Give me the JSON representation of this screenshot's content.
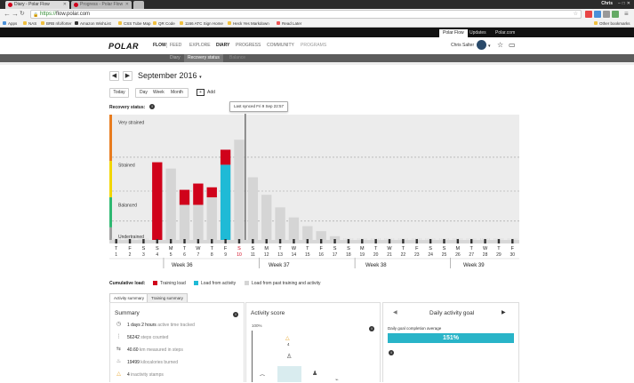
{
  "browser": {
    "tabs": [
      {
        "label": "Diary - Polar Flow",
        "active": true
      },
      {
        "label": "Progress - Polar Flow",
        "active": false
      }
    ],
    "window_user": "Chris",
    "url_scheme": "https://",
    "url_host": "flow.polar.com",
    "bookmarks": [
      "Apps",
      "NAS",
      "BRB nfo/forter",
      "Amazon WishList",
      "CSS Tube Map",
      "QR Code",
      "1166 ATC Sign Home",
      "Heck Yes Markdown",
      "Read Later"
    ],
    "other_bookmarks": "Other bookmarks"
  },
  "polar_top": {
    "tabs": [
      "Polar Flow",
      "Updates",
      "Polar.com"
    ]
  },
  "header": {
    "logo": "POLAR",
    "nav": [
      "FLOW",
      "FEED",
      "EXPLORE",
      "DIARY",
      "PROGRESS",
      "COMMUNITY",
      "PROGRAMS"
    ],
    "active_nav": "DIARY",
    "user_name": "Chris Salter"
  },
  "subnav": {
    "items": [
      "Diary",
      "Recovery status",
      "Balance"
    ],
    "active": "Recovery status"
  },
  "calendar": {
    "month": "September 2016",
    "today": "Today",
    "views": [
      "Day",
      "Week",
      "Month"
    ],
    "add": "Add"
  },
  "recovery": {
    "label": "Recovery status:",
    "tooltip": "Last synced Fri 9 Sep 22:57"
  },
  "chart_data": {
    "type": "bar",
    "levels": [
      "Very strained",
      "Strained",
      "Balanced",
      "Undertrained"
    ],
    "day_letters": [
      "T",
      "F",
      "S",
      "S",
      "M",
      "T",
      "W",
      "T",
      "F",
      "S",
      "S",
      "M",
      "T",
      "W",
      "T",
      "F",
      "S",
      "S",
      "M",
      "T",
      "W",
      "T",
      "F",
      "S",
      "S",
      "M",
      "T",
      "W",
      "T",
      "F"
    ],
    "day_numbers": [
      1,
      2,
      3,
      4,
      5,
      6,
      7,
      8,
      9,
      10,
      11,
      12,
      13,
      14,
      15,
      16,
      17,
      18,
      19,
      20,
      21,
      22,
      23,
      24,
      25,
      26,
      27,
      28,
      29,
      30
    ],
    "today_index": 9,
    "highlight_day": 10,
    "week_labels": [
      "Week 36",
      "Week 37",
      "Week 38",
      "Week 39"
    ],
    "series": [
      {
        "name": "Training load",
        "color": "#d0021b",
        "values": [
          0,
          0,
          0,
          0.62,
          0,
          0.4,
          0.45,
          0.42,
          0.72,
          0,
          0,
          0,
          0,
          0,
          0,
          0,
          0,
          0,
          0,
          0,
          0,
          0,
          0,
          0,
          0,
          0,
          0,
          0,
          0,
          0
        ]
      },
      {
        "name": "Load from activity",
        "color": "#1fbad6",
        "values": [
          0,
          0,
          0,
          0,
          0,
          0,
          0,
          0,
          0.6,
          0,
          0,
          0,
          0,
          0,
          0,
          0,
          0,
          0,
          0,
          0,
          0,
          0,
          0,
          0,
          0,
          0,
          0,
          0,
          0,
          0
        ]
      },
      {
        "name": "Load from past training and activity",
        "color": "#d5d5d5",
        "values": [
          0,
          0,
          0,
          0,
          0.57,
          0.28,
          0.28,
          0.34,
          0.4,
          0.8,
          0.5,
          0.36,
          0.26,
          0.18,
          0.11,
          0.07,
          0.03,
          0,
          0,
          0,
          0,
          0,
          0,
          0,
          0,
          0,
          0,
          0,
          0,
          0
        ]
      }
    ]
  },
  "legend": {
    "label": "Cumulative load:",
    "items": [
      {
        "label": "Training load",
        "color": "#d0021b"
      },
      {
        "label": "Load from activity",
        "color": "#1fbad6"
      },
      {
        "label": "Load from past training and activity",
        "color": "#d5d5d5"
      }
    ]
  },
  "panels": {
    "tabs": [
      "Activity summary",
      "Training summary"
    ],
    "summary": {
      "title": "Summary",
      "rows": [
        {
          "value": "1 days 2 hours",
          "unit": "active time tracked",
          "icon": "clock-icon"
        },
        {
          "value": "56242",
          "unit": "steps counted",
          "icon": "footsteps-icon"
        },
        {
          "value": "40.60",
          "unit": "km measured in steps",
          "icon": "distance-icon"
        },
        {
          "value": "19499",
          "unit": "kilocalories burned",
          "icon": "flame-icon"
        },
        {
          "value": "4",
          "unit": "inactivity stamps",
          "icon": "warning-icon"
        }
      ]
    },
    "activity_score": {
      "title": "Activity score",
      "percent": "100%",
      "stamp_count": "4"
    },
    "goal": {
      "title": "Daily activity goal",
      "subtitle": "Daily goal completion average",
      "percent": "151%",
      "progress": 1.51
    }
  }
}
